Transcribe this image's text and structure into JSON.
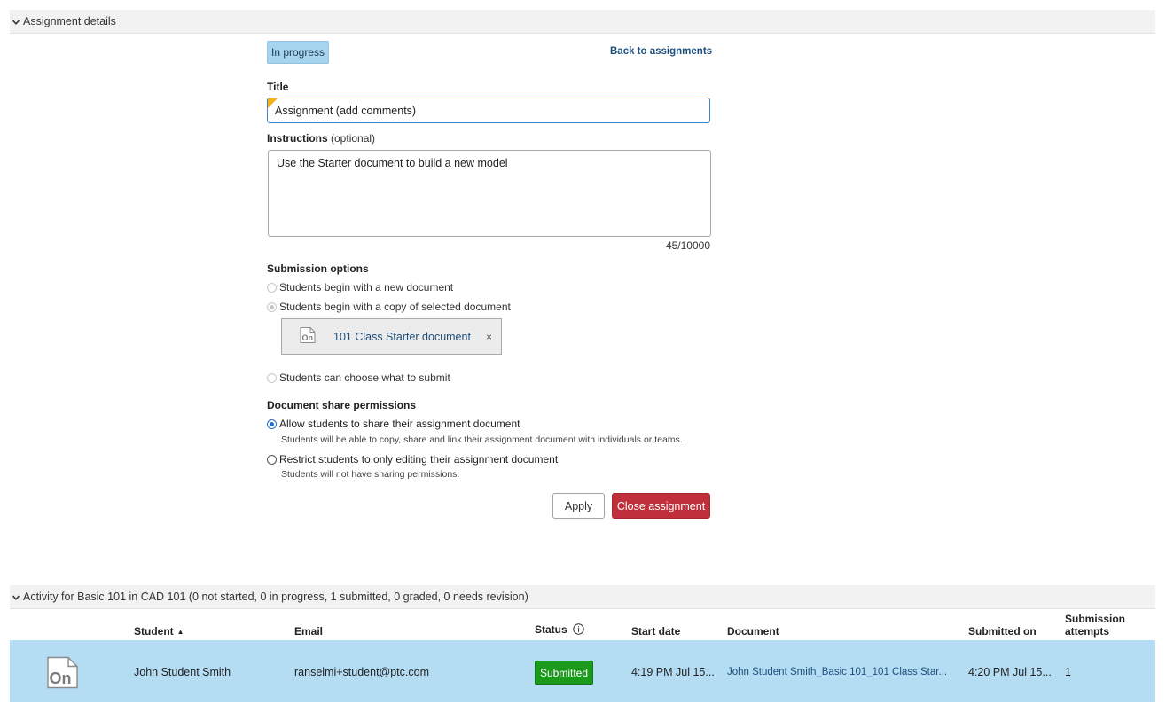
{
  "assignment_section": {
    "header": "Assignment details",
    "status_badge": "In progress",
    "back_link": "Back to assignments",
    "title_label": "Title",
    "title_value": "Assignment (add comments)",
    "instructions_label": "Instructions",
    "instructions_optional": "(optional)",
    "instructions_value": "Use the Starter document to build a new model",
    "char_count": "45/10000",
    "submission_options": {
      "label": "Submission options",
      "new_document": "Students begin with a new document",
      "copy_document": "Students begin with a copy of selected document",
      "selected_document": "101 Class Starter document",
      "remove_symbol": "×",
      "choose_submit": "Students can choose what to submit"
    },
    "share_permissions": {
      "label": "Document share permissions",
      "allow_label": "Allow students to share their assignment document",
      "allow_hint": "Students will be able to copy, share and link their assignment document with individuals or teams.",
      "restrict_label": "Restrict students to only editing their assignment document",
      "restrict_hint": "Students will not have sharing permissions."
    },
    "apply_button": "Apply",
    "close_button": "Close assignment"
  },
  "activity_section": {
    "header": "Activity for Basic 101 in CAD 101 (0 not started, 0 in progress, 1 submitted, 0 graded, 0 needs revision)",
    "columns": {
      "student": "Student",
      "sort_indicator": "▲",
      "email": "Email",
      "status": "Status",
      "start_date": "Start date",
      "document": "Document",
      "submitted_on": "Submitted on",
      "attempts_line1": "Submission",
      "attempts_line2": "attempts"
    },
    "rows": [
      {
        "student": "John Student Smith",
        "email": "ranselmi+student@ptc.com",
        "status": "Submitted",
        "start_date": "4:19 PM Jul 15...",
        "document": "John Student Smith_Basic 101_101 Class Star...",
        "submitted_on": "4:20 PM Jul 15...",
        "attempts": "1"
      }
    ]
  },
  "colors": {
    "badge_in_progress": "#a6d3ee",
    "link": "#1d4f7c",
    "close_button": "#c0303c",
    "status_submitted": "#1b9a1b",
    "row_selected": "#b4ddf4",
    "section_header_bg": "#f2f2f2"
  },
  "icons": [
    "chevron-down-icon",
    "onshape-document-icon",
    "info-icon",
    "close-icon"
  ]
}
